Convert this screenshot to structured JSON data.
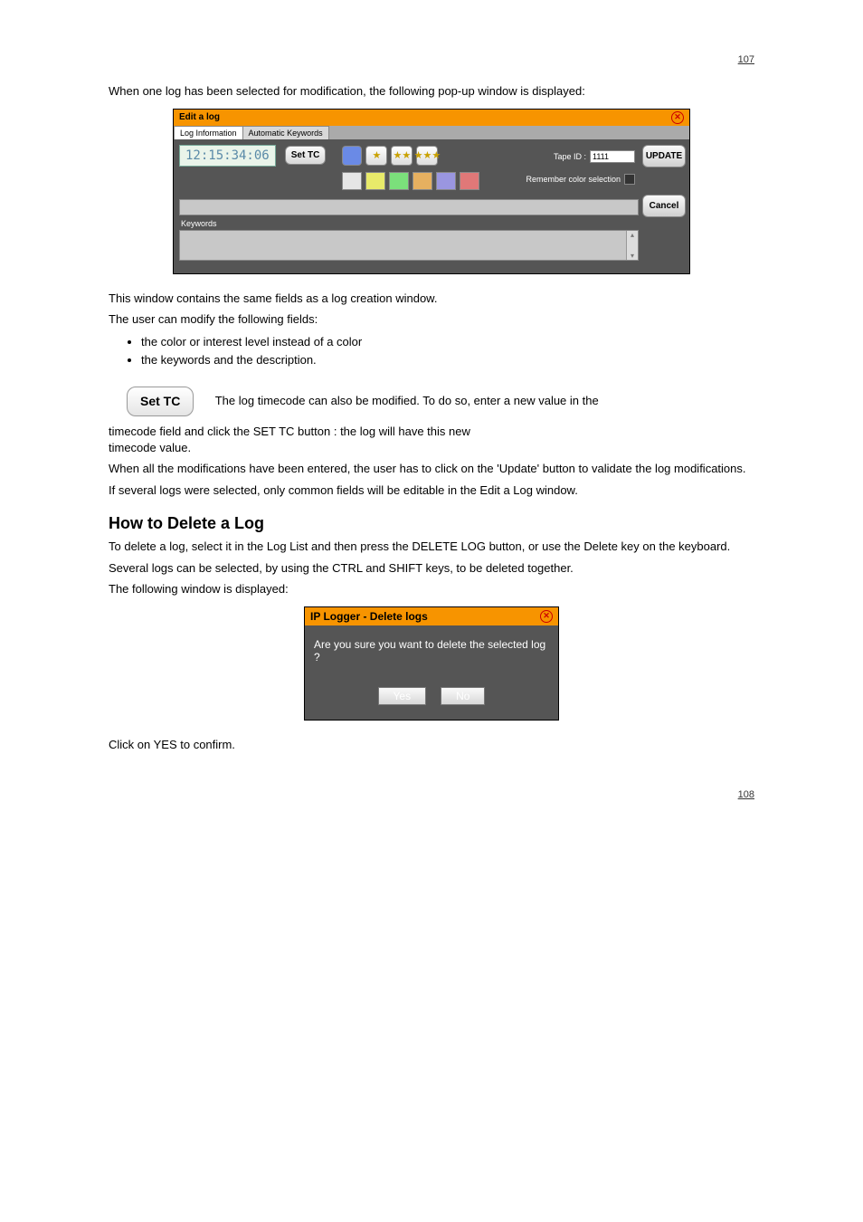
{
  "page_num_top": "107",
  "page_num_bottom": "108",
  "intro1": "When one log has been selected for modification, the following pop-up window is displayed:",
  "win1": {
    "title": "Edit a log",
    "tabs": {
      "active": "Log Information",
      "other": "Automatic Keywords"
    },
    "timecode": "12:15:34:06",
    "set_tc": "Set TC",
    "tape_label": "Tape ID :",
    "tape_value": "1111",
    "remember": "Remember color selection",
    "keywords_label": "Keywords",
    "update": "UPDATE",
    "cancel": "Cancel"
  },
  "swatches_row2": [
    "#e6e6e6",
    "#e8ea6a",
    "#7be07b",
    "#e6b060",
    "#9a96e0",
    "#e07878"
  ],
  "after1_p1": "This window contains the same fields as a log creation window.",
  "after1_p2": "The user can modify the following fields:",
  "bullets": [
    "the color or interest level instead of a color",
    "the keywords and the description."
  ],
  "settc": {
    "btn_label": "Set TC",
    "p1": "The log timecode can also be modified. To do so, enter a new value in the",
    "p2": ": the log will have this new",
    "p3": "timecode value.",
    "line2": "timecode field and click the SET TC button"
  },
  "update_p1": "When all the modifications have been entered, the user has to click on the 'Update' button to validate the log modifications.",
  "update_p2": "If several logs were selected, only common fields will be editable in the Edit a Log window.",
  "heading_delete": "How to Delete a Log",
  "delete_p1": "To delete a log, select it in the Log List and then press the DELETE LOG button, or use the Delete key on the keyboard.",
  "delete_p2": "Several logs can be selected, by using the CTRL and SHIFT keys, to be deleted together.",
  "delete_p3": "The following window is displayed:",
  "win2": {
    "title": "IP Logger - Delete logs",
    "msg": "Are you sure you want to delete the selected log ?",
    "yes": "Yes",
    "no": "No"
  },
  "final": "Click on YES to confirm."
}
